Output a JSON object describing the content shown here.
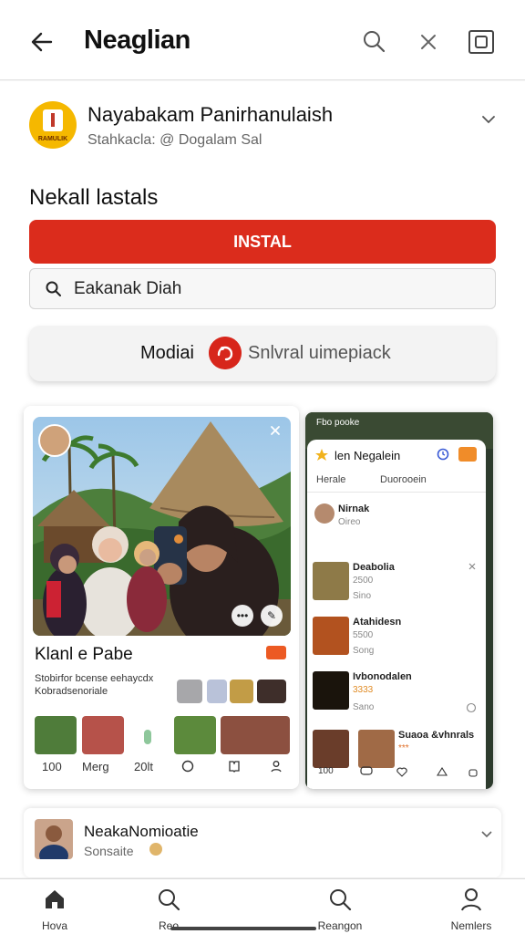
{
  "header": {
    "title": "Neaglian"
  },
  "app": {
    "name": "Nayabakam Panirhanulaish",
    "subtitle": "Stahkacla: @ Dogalam Sal",
    "logo_text": "RAMULIK"
  },
  "section_title": "Nekall lastals",
  "install_label": "INSTAL",
  "search": {
    "value": "Eakanak Diah"
  },
  "mode": {
    "left_label": "Modiai",
    "right_label": "Snlvral uimepiack"
  },
  "card_left": {
    "title": "Klanl e Pabe",
    "description_line1": "Stobirfor bcense eehaycdx",
    "description_line2": "Kobradsenoriale",
    "footer": [
      "100",
      "Merg",
      "20lt"
    ]
  },
  "card_right": {
    "top_label": "Fbo pooke",
    "header_title": "len Negalein",
    "tabs": [
      "Herale",
      "Duorooein"
    ],
    "rows": [
      {
        "title": "Nirnak",
        "sub": "Oireo"
      },
      {
        "title": "Deabolia",
        "sub": "2500",
        "sub2": "Sino"
      },
      {
        "title": "Atahidesn",
        "sub": "5500",
        "sub2": "Song"
      },
      {
        "title": "Ivbonodalen",
        "sub": "3333",
        "sub2": "Sano"
      },
      {
        "title": "Suaoa &vhnrals",
        "sub": "***"
      }
    ],
    "footer": [
      "100"
    ]
  },
  "profile": {
    "name": "NeakaNomioatie",
    "sub": "Sonsaite"
  },
  "nav": {
    "items": [
      "Hova",
      "Reo",
      "Reangon",
      "Nemlers"
    ]
  },
  "colors": {
    "accent_red": "#db2c1c",
    "logo_yellow": "#f5b800",
    "badge_orange": "#ec5a23"
  }
}
